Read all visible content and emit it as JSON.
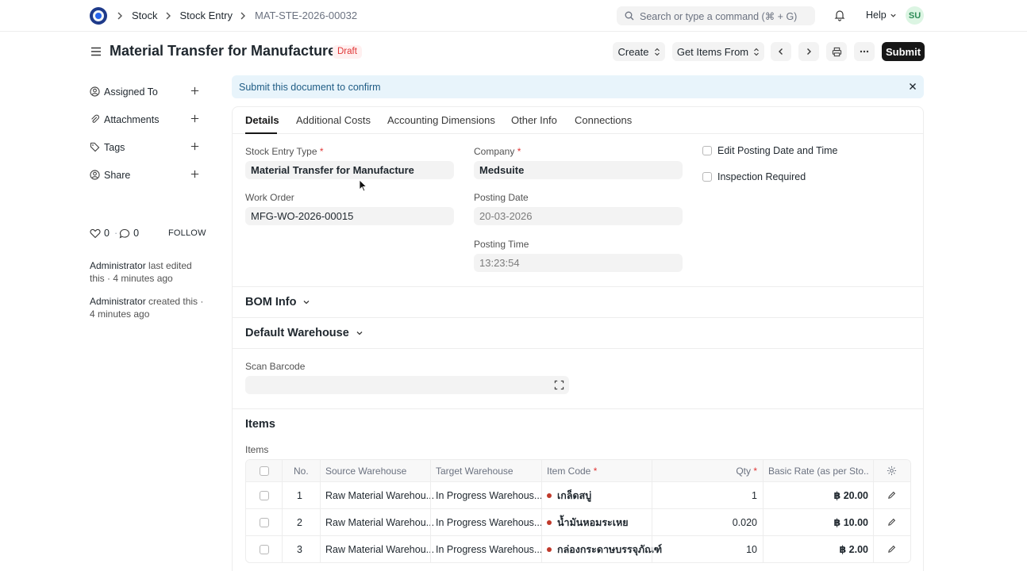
{
  "navbar": {
    "breadcrumbs": [
      "Stock",
      "Stock Entry",
      "MAT-STE-2026-00032"
    ],
    "search_placeholder": "Search or type a command (⌘ + G)",
    "help_label": "Help",
    "avatar_initials": "SU"
  },
  "page": {
    "title": "Material Transfer for Manufacture",
    "status": "Draft",
    "buttons": {
      "create": "Create",
      "get_items_from": "Get Items From",
      "submit": "Submit"
    }
  },
  "sidebar": {
    "items": [
      {
        "label": "Assigned To",
        "icon": "user-add-icon"
      },
      {
        "label": "Attachments",
        "icon": "paperclip-icon"
      },
      {
        "label": "Tags",
        "icon": "tag-icon"
      },
      {
        "label": "Share",
        "icon": "share-icon"
      }
    ],
    "likes_count": "0",
    "likes_sep": "·",
    "comments_count": "0",
    "follow_label": "FOLLOW",
    "activity": [
      {
        "who": "Administrator",
        "text": " last edited this · 4 minutes ago"
      },
      {
        "who": "Administrator",
        "text": " created this · 4 minutes ago"
      }
    ]
  },
  "alert": {
    "text": "Submit this document to confirm"
  },
  "tabs": [
    "Details",
    "Additional Costs",
    "Accounting Dimensions",
    "Other Info",
    "Connections"
  ],
  "form": {
    "stock_entry_type": {
      "label": "Stock Entry Type",
      "value": "Material Transfer for Manufacture"
    },
    "work_order": {
      "label": "Work Order",
      "value": "MFG-WO-2026-00015"
    },
    "company": {
      "label": "Company",
      "value": "Medsuite"
    },
    "posting_date": {
      "label": "Posting Date",
      "value": "20-03-2026"
    },
    "posting_time": {
      "label": "Posting Time",
      "value": "13:23:54"
    },
    "edit_posting": {
      "label": "Edit Posting Date and Time"
    },
    "inspection_required": {
      "label": "Inspection Required"
    },
    "required_mark": "*"
  },
  "sections": {
    "bom_info": "BOM Info",
    "default_warehouse": "Default Warehouse",
    "scan_barcode_label": "Scan Barcode",
    "items_title": "Items",
    "items_label": "Items"
  },
  "items_table": {
    "columns": [
      "No.",
      "Source Warehouse",
      "Target Warehouse",
      "Item Code",
      "Qty",
      "Basic Rate (as per Sto..."
    ],
    "rows": [
      {
        "no": "1",
        "source": "Raw Material Warehou...",
        "target": "In Progress Warehous...",
        "item": "เกล็ดสบู่",
        "qty": "1",
        "rate": "฿ 20.00"
      },
      {
        "no": "2",
        "source": "Raw Material Warehou...",
        "target": "In Progress Warehous...",
        "item": "น้ำมันหอมระเหย",
        "qty": "0.020",
        "rate": "฿ 10.00"
      },
      {
        "no": "3",
        "source": "Raw Material Warehou...",
        "target": "In Progress Warehous...",
        "item": "กล่องกระดาษบรรจุภัณฑ์",
        "qty": "10",
        "rate": "฿ 2.00"
      }
    ]
  },
  "colors": {
    "primary": "#171717",
    "draft_badge": "#e03636",
    "alert_bg": "#e8f4fb",
    "item_dot": "#c0392b"
  }
}
